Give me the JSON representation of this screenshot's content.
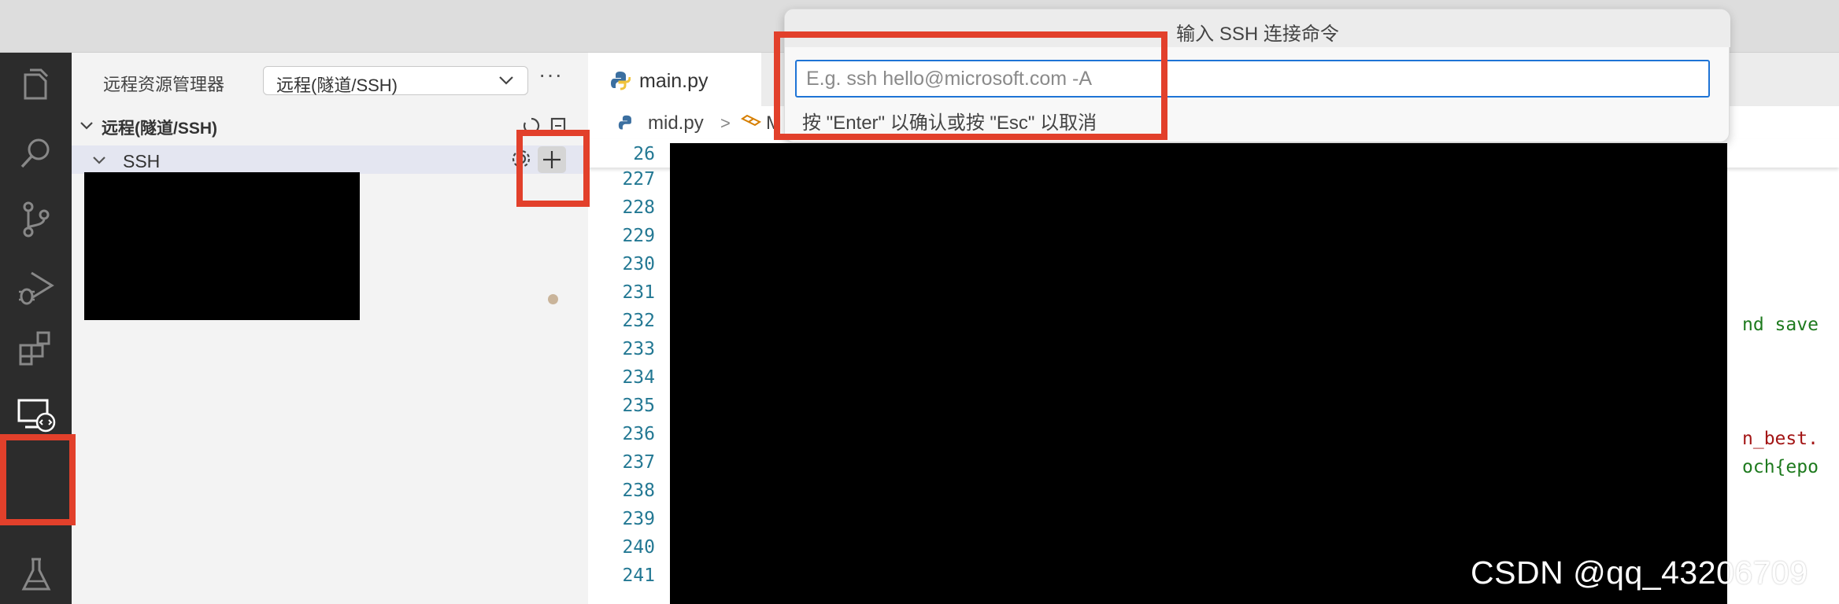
{
  "sidebar": {
    "title": "远程资源管理器",
    "selector_value": "远程(隧道/SSH)",
    "more": "···",
    "section_label": "远程(隧道/SSH)",
    "ssh_label": "SSH"
  },
  "editor": {
    "tab_label": "main.py",
    "breadcrumb_file": "mid.py",
    "breadcrumb_sep": ">",
    "breadcrumb_symbol": "M",
    "sticky_line": "26",
    "line_numbers": [
      "227",
      "228",
      "229",
      "230",
      "231",
      "232",
      "233",
      "234",
      "235",
      "236",
      "237",
      "238",
      "239",
      "240",
      "241"
    ],
    "visible_code_fragments": [
      "nd save",
      "n_best.",
      "och{epo"
    ]
  },
  "quick_input": {
    "title": "输入 SSH 连接命令",
    "placeholder": "E.g. ssh hello@microsoft.com -A",
    "hint": "按 \"Enter\" 以确认或按 \"Esc\" 以取消"
  },
  "watermark": "CSDN @qq_43206709",
  "colors": {
    "highlight": "#e2402b",
    "focus_border": "#1e74d6",
    "line_number": "#237893",
    "activity_bar": "#2c2c2c"
  },
  "icons": [
    "explorer-icon",
    "search-icon",
    "source-control-icon",
    "run-debug-icon",
    "extensions-icon",
    "remote-explorer-icon",
    "testing-icon",
    "chevron-down-icon",
    "gear-icon",
    "plus-icon",
    "python-file-icon",
    "symbol-icon"
  ]
}
